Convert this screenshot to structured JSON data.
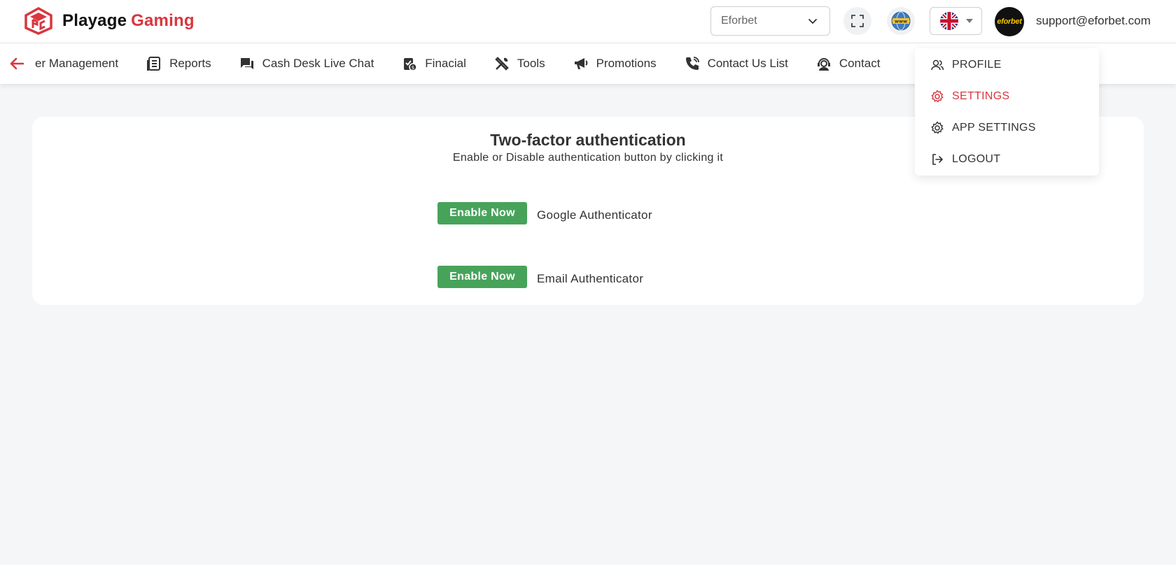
{
  "brand": {
    "name_part1": "Playage",
    "name_part2": "Gaming",
    "accent": "#d9363e"
  },
  "header": {
    "site_select_value": "Eforbet",
    "avatar_text": "eforbet",
    "user_email": "support@eforbet.com"
  },
  "nav": {
    "items": [
      {
        "label": "er Management",
        "icon": "users-icon"
      },
      {
        "label": "Reports",
        "icon": "reports-icon"
      },
      {
        "label": "Cash Desk Live Chat",
        "icon": "chat-icon"
      },
      {
        "label": "Finacial",
        "icon": "financial-icon"
      },
      {
        "label": "Tools",
        "icon": "tools-icon"
      },
      {
        "label": "Promotions",
        "icon": "megaphone-icon"
      },
      {
        "label": "Contact Us List",
        "icon": "phone-icon"
      },
      {
        "label": "Contact",
        "icon": "support-agent-icon"
      }
    ]
  },
  "card": {
    "title": "Two-factor authentication",
    "subtitle": "Enable or Disable authentication button by clicking it",
    "rows": [
      {
        "button": "Enable Now",
        "label": "Google Authenticator"
      },
      {
        "button": "Enable Now",
        "label": "Email Authenticator"
      }
    ],
    "button_color": "#47a35a"
  },
  "dropdown": {
    "items": [
      {
        "label": "PROFILE",
        "icon": "users-icon",
        "active": false
      },
      {
        "label": "SETTINGS",
        "icon": "gear-icon",
        "active": true
      },
      {
        "label": "APP SETTINGS",
        "icon": "gear-icon",
        "active": false
      },
      {
        "label": "LOGOUT",
        "icon": "logout-icon",
        "active": false
      }
    ]
  }
}
